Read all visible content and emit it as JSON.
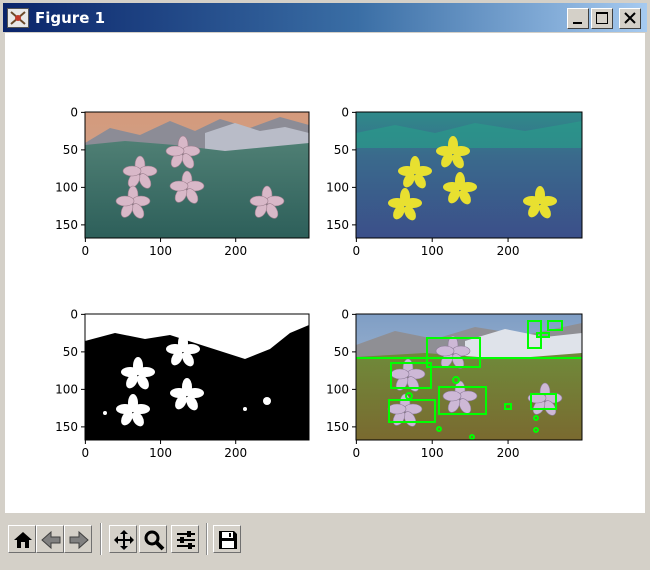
{
  "window": {
    "title": "Figure 1",
    "controls": [
      "minimize",
      "maximize",
      "close"
    ]
  },
  "toolbar": {
    "buttons": [
      {
        "name": "home",
        "icon": "home-icon"
      },
      {
        "name": "back",
        "icon": "arrow-left-icon"
      },
      {
        "name": "forward",
        "icon": "arrow-right-icon"
      },
      {
        "name": "pan",
        "icon": "move-icon"
      },
      {
        "name": "zoom",
        "icon": "magnifier-icon"
      },
      {
        "name": "configure-subplots",
        "icon": "sliders-icon"
      },
      {
        "name": "save",
        "icon": "floppy-disk-icon"
      }
    ]
  },
  "figure": {
    "subplots": [
      {
        "id": "original",
        "content": "flower field photo, color-shifted",
        "x_ticks": [
          "0",
          "100",
          "200"
        ],
        "y_ticks": [
          "0",
          "50",
          "100",
          "150"
        ]
      },
      {
        "id": "saliency",
        "content": "single-channel map, viridis colormap",
        "x_ticks": [
          "0",
          "100",
          "200"
        ],
        "y_ticks": [
          "0",
          "50",
          "100",
          "150"
        ]
      },
      {
        "id": "mask",
        "content": "binary threshold mask",
        "x_ticks": [
          "0",
          "100",
          "200"
        ],
        "y_ticks": [
          "0",
          "50",
          "100",
          "150"
        ]
      },
      {
        "id": "detections",
        "content": "photo with green bounding boxes",
        "x_ticks": [
          "0",
          "100",
          "200"
        ],
        "y_ticks": [
          "0",
          "50",
          "100",
          "150"
        ]
      }
    ],
    "colors": {
      "box": "#00ff00",
      "viridis_low": "#3e4a89",
      "viridis_mid": "#26828e",
      "viridis_high": "#fde725"
    }
  }
}
